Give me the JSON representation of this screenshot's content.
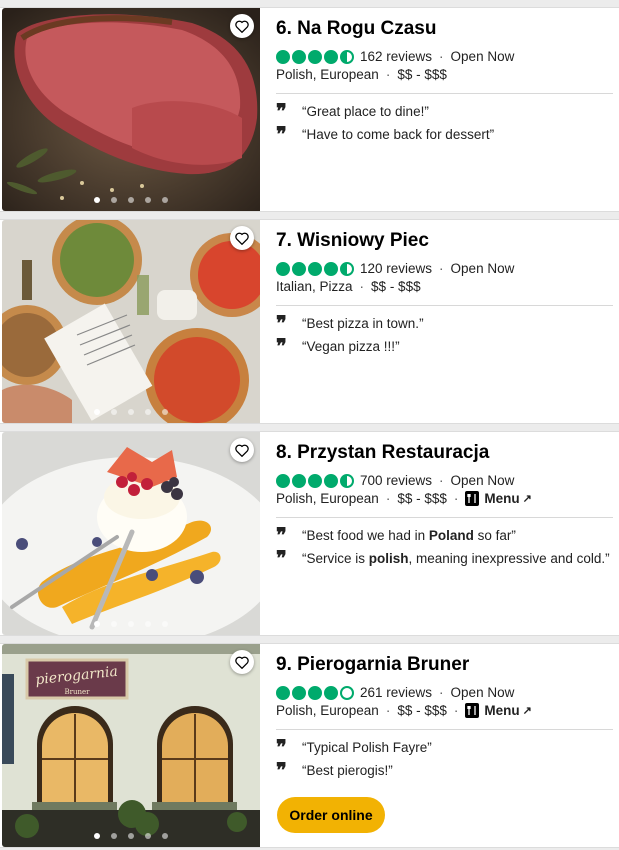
{
  "colors": {
    "bubble": "#00aa6c",
    "order_button": "#f2b203"
  },
  "restaurants": [
    {
      "title": "6. Na Rogu Czasu",
      "rating": 4.5,
      "reviews": "162 reviews",
      "status": "Open Now",
      "cuisine": "Polish, European",
      "price": "$$ - $$$",
      "menu": "",
      "review1": "Great place to dine!",
      "review2": "Have to come back for dessert",
      "photo": "steak",
      "photo_index": 1,
      "photo_count": 5
    },
    {
      "title": "7. Wisniowy Piec",
      "rating": 4.5,
      "reviews": "120 reviews",
      "status": "Open Now",
      "cuisine": "Italian, Pizza",
      "price": "$$ - $$$",
      "menu": "",
      "review1": "Best pizza in town.",
      "review2": "Vegan pizza !!!",
      "photo": "pizza",
      "photo_index": 1,
      "photo_count": 5
    },
    {
      "title": "8. Przystan Restauracja",
      "rating": 4.5,
      "reviews": "700 reviews",
      "status": "Open Now",
      "cuisine": "Polish, European",
      "price": "$$ - $$$",
      "menu": "Menu",
      "review1_parts": [
        "Best food we had in ",
        "Poland",
        " so far"
      ],
      "review2_parts": [
        "Service is ",
        "polish",
        ", meaning inexpressive and cold."
      ],
      "photo": "dessert",
      "photo_index": 1,
      "photo_count": 5
    },
    {
      "title": "9. Pierogarnia Bruner",
      "rating": 4.0,
      "reviews": "261 reviews",
      "status": "Open Now",
      "cuisine": "Polish, European",
      "price": "$$ - $$$",
      "menu": "Menu",
      "review1": "Typical Polish Fayre",
      "review2": "Best pierogis!",
      "order_label": "Order online",
      "photo": "storefront",
      "sign_text": "pierogarnia",
      "sign_subtext": "Bruner",
      "photo_index": 1,
      "photo_count": 5
    }
  ]
}
